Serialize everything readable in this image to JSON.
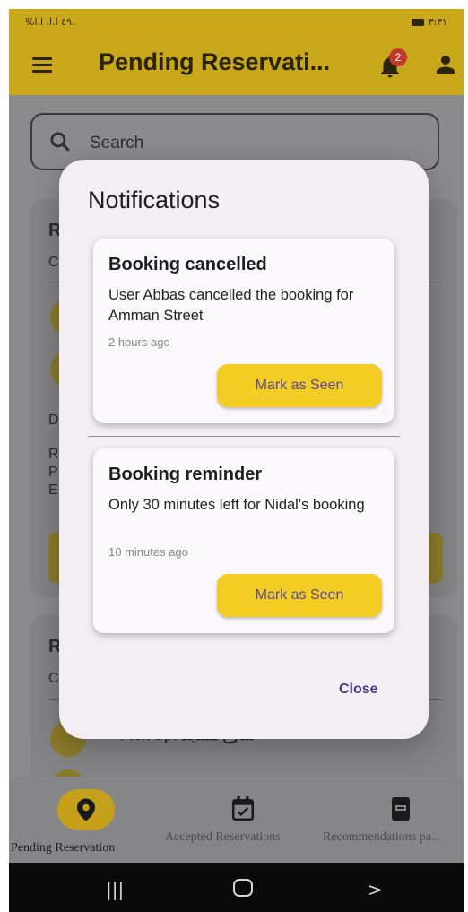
{
  "status_bar": {
    "left_text": "%٤٩ ا.ا. ا.ا.",
    "time": "٣:٣١"
  },
  "app_bar": {
    "title": "Pending Reservati...",
    "notification_count": "2",
    "color": "#c9a71b"
  },
  "search": {
    "placeholder": "Search"
  },
  "dialog": {
    "title": "Notifications",
    "notifications": [
      {
        "title": "Booking cancelled",
        "body": "User Abbas cancelled the booking for Amman Street",
        "time": "2 hours ago",
        "action": "Mark as Seen"
      },
      {
        "title": "Booking reminder",
        "body": "Only 30 minutes left for Nidal's booking",
        "time": "10 minutes ago",
        "action": "Mark as Seen"
      }
    ],
    "close_label": "Close"
  },
  "background": {
    "card_letters": [
      "R",
      "C",
      "D",
      "R",
      "P",
      "E",
      "R",
      "C"
    ],
    "pickup_text": "Pick Up: شارع مسجد"
  },
  "bottom_nav": {
    "items": [
      {
        "label": "Pending Reservation",
        "icon": "location-pin-icon",
        "active": true
      },
      {
        "label": "Accepted Reservations",
        "icon": "calendar-check-icon",
        "active": false
      },
      {
        "label": "Recommendations pa...",
        "icon": "book-icon",
        "active": false
      }
    ]
  },
  "colors": {
    "accent": "#f3cd24",
    "dialog_bg": "#f3eef4",
    "link": "#4a3a86"
  }
}
